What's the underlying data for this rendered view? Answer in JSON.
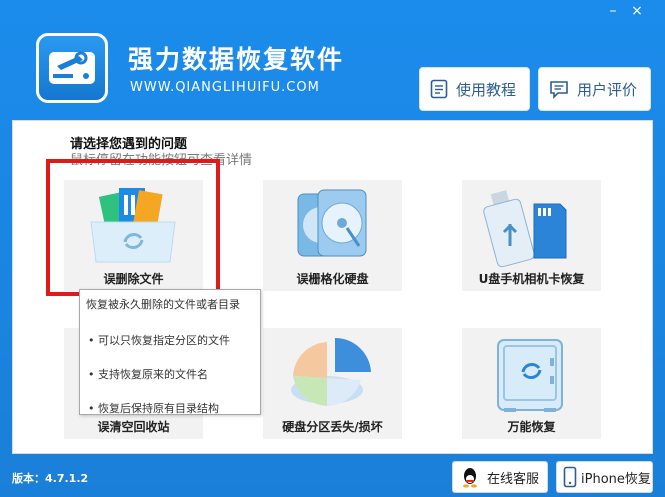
{
  "app": {
    "title": "强力数据恢复软件",
    "url": "WWW.QIANGLIHUIFU.COM",
    "version": "版本：4.7.1.2"
  },
  "header": {
    "tutorial_label": "使用教程",
    "review_label": "用户评价"
  },
  "window_controls": {
    "minimize": "–",
    "close": "×"
  },
  "main": {
    "heading": "请选择您遇到的问题",
    "subheading": "鼠标停留在功能按钮可查看详情",
    "cards": [
      {
        "label": "误删除文件"
      },
      {
        "label": "误栅格化硬盘"
      },
      {
        "label": "U盘手机相机卡恢复"
      },
      {
        "label": "误清空回收站"
      },
      {
        "label": "硬盘分区丢失/损坏"
      },
      {
        "label": "万能恢复"
      }
    ]
  },
  "tooltip": {
    "title": "恢复被永久删除的文件或者目录",
    "items": [
      "• 可以只恢复指定分区的文件",
      "• 支持恢复原来的文件名",
      "• 恢复后保持原有目录结构"
    ]
  },
  "footer": {
    "online_service": "在线客服",
    "iphone_recovery": "iPhone恢复"
  },
  "colors": {
    "brand_blue": "#1b8cec",
    "highlight_red": "#e01a1a"
  }
}
